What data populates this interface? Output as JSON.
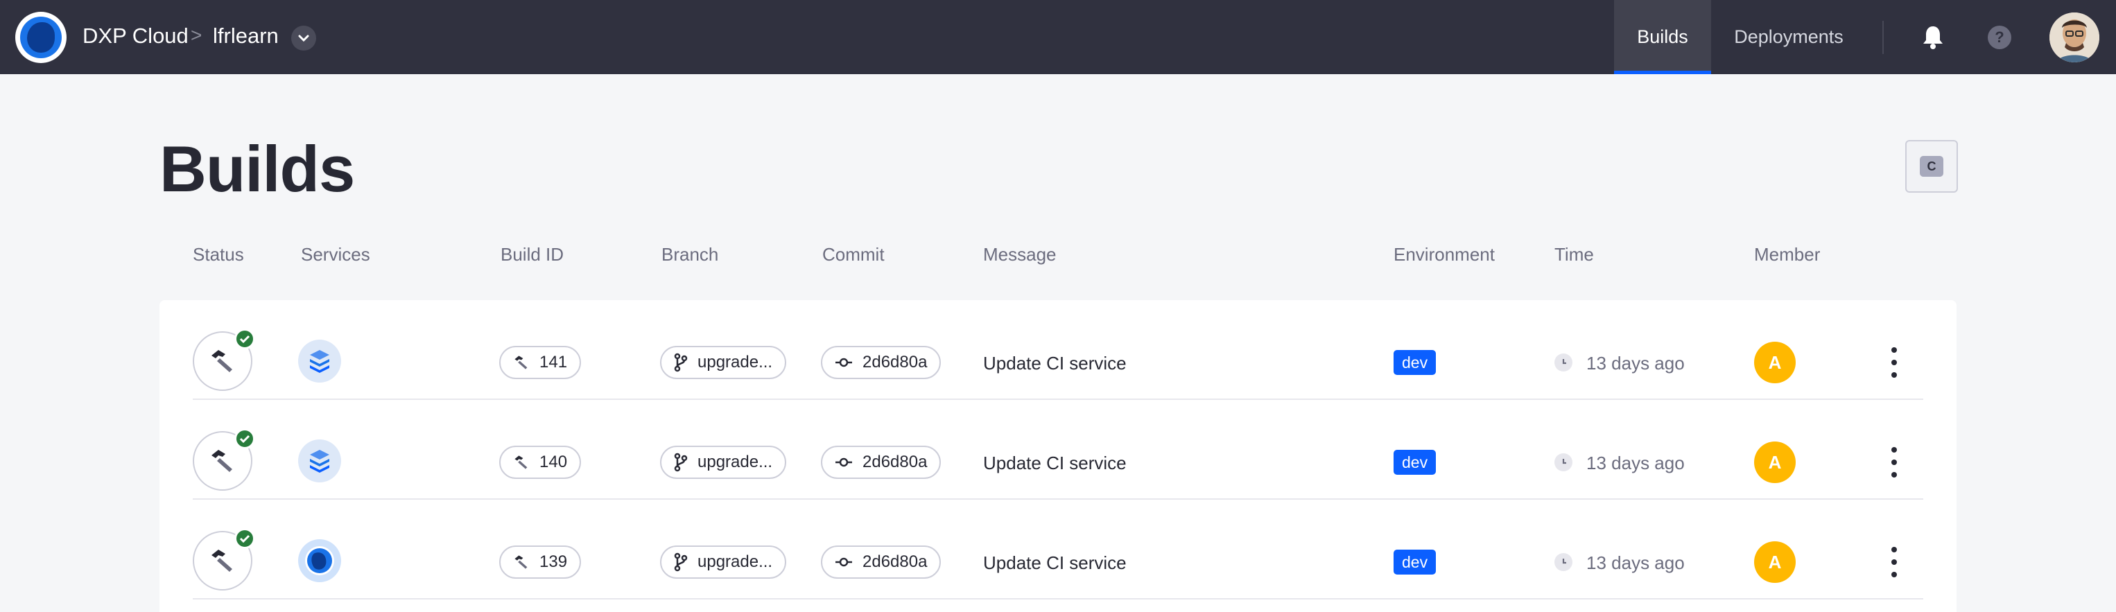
{
  "header": {
    "brand": "DXP Cloud",
    "separator": ">",
    "project": "lfrlearn",
    "tabs": [
      {
        "label": "Builds",
        "active": true
      },
      {
        "label": "Deployments",
        "active": false
      }
    ],
    "help_glyph": "?",
    "icons": [
      "dxp-cloud-logo-icon",
      "chevron-down-icon",
      "bell-icon",
      "help-icon",
      "user-avatar"
    ]
  },
  "page": {
    "title": "Builds",
    "ci_button_label": "C"
  },
  "columns": [
    "Status",
    "Services",
    "Build ID",
    "Branch",
    "Commit",
    "Message",
    "Environment",
    "Time",
    "Member"
  ],
  "builds": [
    {
      "status": "success",
      "service_icon": "layers-icon",
      "build_id": "141",
      "branch": "upgrade...",
      "commit": "2d6d80a",
      "message": "Update CI service",
      "environment": "dev",
      "time": "13 days ago",
      "member_initial": "A"
    },
    {
      "status": "success",
      "service_icon": "layers-icon",
      "build_id": "140",
      "branch": "upgrade...",
      "commit": "2d6d80a",
      "message": "Update CI service",
      "environment": "dev",
      "time": "13 days ago",
      "member_initial": "A"
    },
    {
      "status": "success",
      "service_icon": "liferay-logo-icon",
      "build_id": "139",
      "branch": "upgrade...",
      "commit": "2d6d80a",
      "message": "Update CI service",
      "environment": "dev",
      "time": "13 days ago",
      "member_initial": "A"
    }
  ],
  "colors": {
    "nav_bg": "#30313f",
    "accent": "#0b5fff",
    "success": "#287d3c",
    "member": "#ffb800"
  }
}
